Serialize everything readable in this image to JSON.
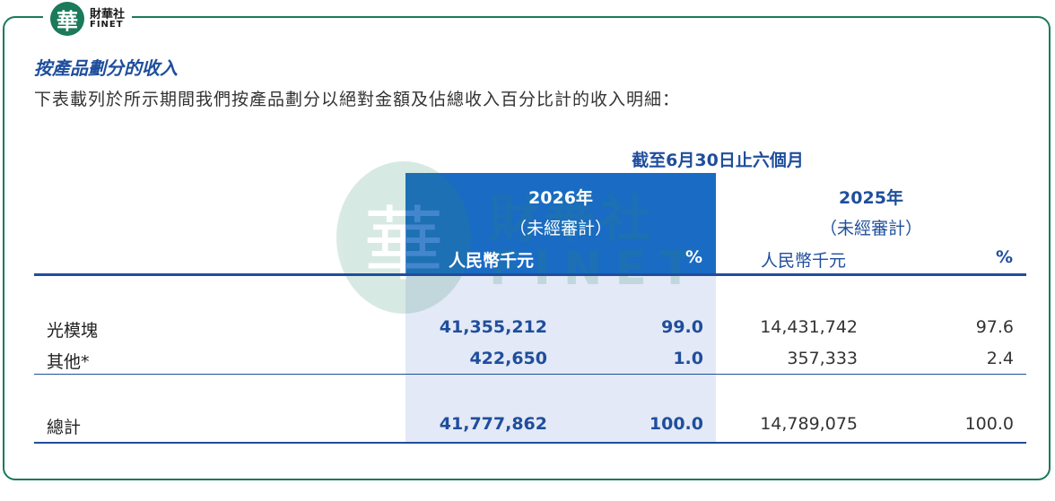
{
  "logo": {
    "mark": "華",
    "cn": "財華社",
    "en": "FINET"
  },
  "section_title": "按產品劃分的收入",
  "description": "下表載列於所示期間我們按產品劃分以絕對金額及佔總收入百分比計的收入明細：",
  "watermark": {
    "mark": "華",
    "cn": "財華社",
    "en": "FINET"
  },
  "table": {
    "period_header": "截至6月30日止六個月",
    "years": [
      {
        "year": "2026年",
        "audit": "（未經審計）",
        "col_amount": "人民幣千元",
        "col_pct": "%"
      },
      {
        "year": "2025年",
        "audit": "（未經審計）",
        "col_amount": "人民幣千元",
        "col_pct": "%"
      }
    ],
    "rows": [
      {
        "label": "光模塊",
        "cur_amount": "41,355,212",
        "cur_pct": "99.0",
        "prev_amount": "14,431,742",
        "prev_pct": "97.6"
      },
      {
        "label": "其他*",
        "cur_amount": "422,650",
        "cur_pct": "1.0",
        "prev_amount": "357,333",
        "prev_pct": "2.4"
      }
    ],
    "total": {
      "label": "總計",
      "cur_amount": "41,777,862",
      "cur_pct": "100.0",
      "prev_amount": "14,789,075",
      "prev_pct": "100.0"
    }
  },
  "colors": {
    "frame": "#1a7a5a",
    "accent_blue": "#1f4e9c",
    "highlight_blue": "#1a6bc4",
    "pale_blue": "#e3e9f6"
  }
}
